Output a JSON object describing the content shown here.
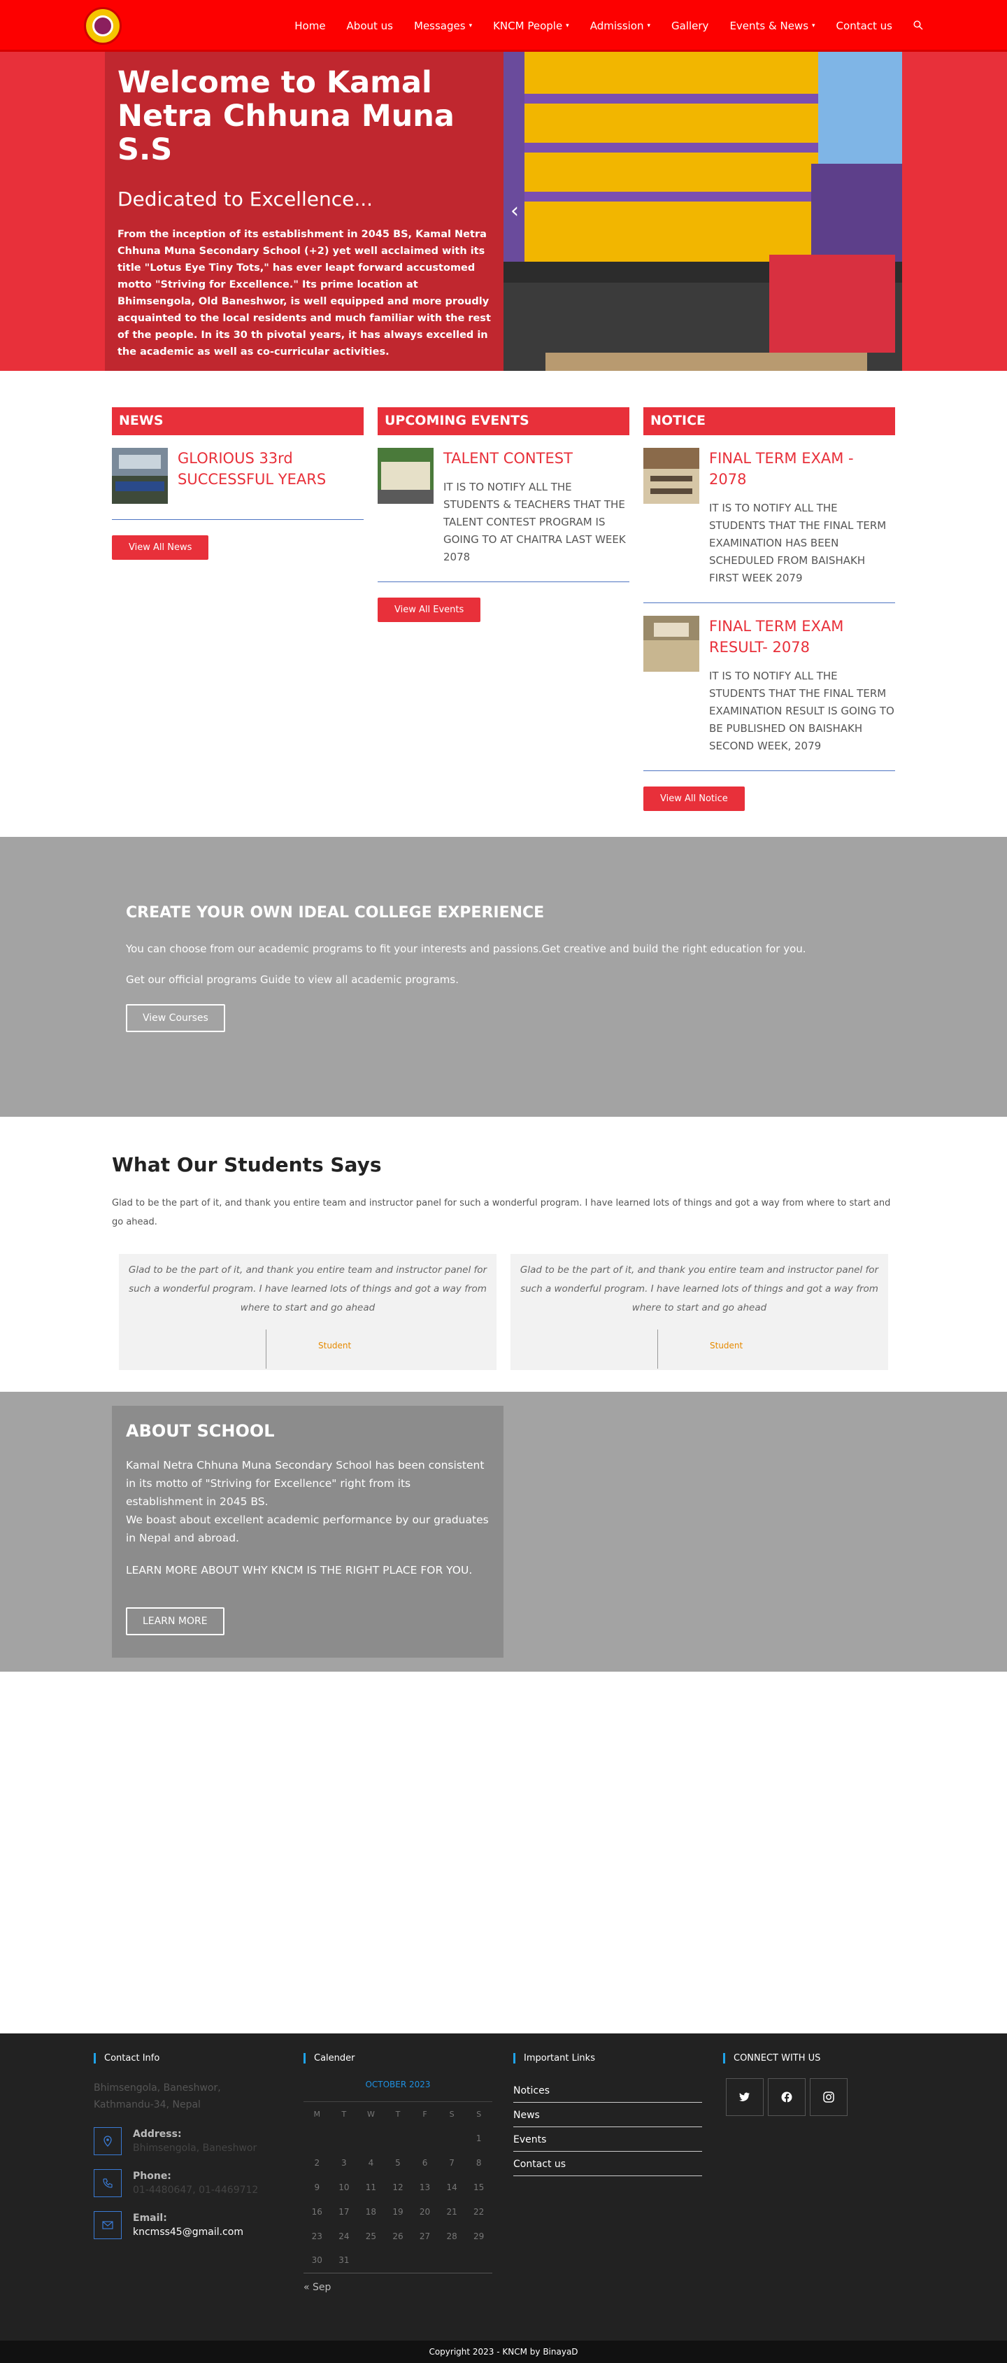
{
  "nav": {
    "items": [
      {
        "label": "Home",
        "dropdown": false
      },
      {
        "label": "About us",
        "dropdown": false
      },
      {
        "label": "Messages",
        "dropdown": true
      },
      {
        "label": "KNCM People",
        "dropdown": true
      },
      {
        "label": "Admission",
        "dropdown": true
      },
      {
        "label": "Gallery",
        "dropdown": false
      },
      {
        "label": "Events & News",
        "dropdown": true
      },
      {
        "label": "Contact us",
        "dropdown": false
      }
    ],
    "caret": "▾"
  },
  "hero": {
    "title": "Welcome to Kamal Netra Chhuna Muna S.S",
    "subtitle": "Dedicated to Excellence...",
    "body": "From the inception of its establishment in 2045 BS, Kamal Netra Chhuna Muna Secondary School (+2) yet well acclaimed with its title \"Lotus Eye Tiny Tots,\" has ever leapt forward accustomed motto \"Striving for Excellence.\" Its prime location at Bhimsengola, Old Baneshwor, is well equipped and more proudly acquainted to the local residents and much familiar with the rest of the people. In its 30 th pivotal years, it has always excelled in the academic as well as co-curricular activities.",
    "prev_arrow": "‹"
  },
  "news": {
    "heading": "NEWS",
    "items": [
      {
        "title": "GLORIOUS 33rd SUCCESSFUL YEARS"
      }
    ],
    "button": "View All News"
  },
  "events": {
    "heading": "UPCOMING EVENTS",
    "items": [
      {
        "title": "TALENT CONTEST",
        "desc": "IT IS TO NOTIFY ALL THE STUDENTS & TEACHERS THAT THE TALENT CONTEST PROGRAM IS GOING TO AT CHAITRA LAST WEEK 2078"
      }
    ],
    "button": "View All Events"
  },
  "notice": {
    "heading": "NOTICE",
    "items": [
      {
        "title": "FINAL TERM EXAM - 2078",
        "desc": "IT IS TO NOTIFY ALL THE STUDENTS THAT THE FINAL TERM EXAMINATION HAS BEEN SCHEDULED FROM BAISHAKH FIRST WEEK 2079"
      },
      {
        "title": "FINAL TERM EXAM RESULT- 2078",
        "desc": "IT IS TO NOTIFY ALL THE STUDENTS THAT THE FINAL TERM EXAMINATION RESULT IS GOING TO BE PUBLISHED ON BAISHAKH SECOND WEEK, 2079"
      }
    ],
    "button": "View All Notice"
  },
  "cta": {
    "title": "CREATE YOUR OWN IDEAL COLLEGE EXPERIENCE",
    "line1": "You can choose from our academic programs to fit your interests and passions.Get creative and build the right education for you.",
    "line2": "Get our official programs Guide to view all academic programs.",
    "button": "View Courses"
  },
  "testimonials": {
    "title": "What Our Students Says",
    "intro": "Glad to be the part of it, and thank you entire team and instructor panel for such a wonderful program. I have learned lots of things and got a way from where to start and go ahead.",
    "cards": [
      {
        "quote": "Glad to be the part of it, and thank you entire team and instructor panel for such a wonderful program. I have learned lots of things and got a way from where to start and go ahead",
        "role": "Student"
      },
      {
        "quote": "Glad to be the part of it, and thank you entire team and instructor panel for such a wonderful program. I have learned lots of things and got a way from where to start and go ahead",
        "role": "Student"
      }
    ]
  },
  "about": {
    "title": "ABOUT SCHOOL",
    "p1": "Kamal Netra Chhuna Muna Secondary School has been consistent in its motto of \"Striving for Excellence\" right from its establishment in 2045 BS.",
    "p2": "We boast about excellent academic performance by our graduates in Nepal and abroad.",
    "p3": "LEARN MORE ABOUT WHY KNCM IS THE RIGHT PLACE FOR YOU.",
    "button": "LEARN MORE"
  },
  "footer": {
    "contact": {
      "heading": "Contact Info",
      "location": "Bhimsengola, Baneshwor, Kathmandu-34, Nepal",
      "address_label": "Address:",
      "address": "Bhimsengola, Baneshwor",
      "phone_label": "Phone:",
      "phone": "01-4480647, 01-4469712",
      "email_label": "Email:",
      "email": "kncmss45@gmail.com"
    },
    "calendar": {
      "heading": "Calender",
      "month": "OCTOBER 2023",
      "weekdays": [
        "M",
        "T",
        "W",
        "T",
        "F",
        "S",
        "S"
      ],
      "weeks": [
        [
          "",
          "",
          "",
          "",
          "",
          "",
          "1"
        ],
        [
          "2",
          "3",
          "4",
          "5",
          "6",
          "7",
          "8"
        ],
        [
          "9",
          "10",
          "11",
          "12",
          "13",
          "14",
          "15"
        ],
        [
          "16",
          "17",
          "18",
          "19",
          "20",
          "21",
          "22"
        ],
        [
          "23",
          "24",
          "25",
          "26",
          "27",
          "28",
          "29"
        ],
        [
          "30",
          "31",
          "",
          "",
          "",
          "",
          ""
        ]
      ],
      "prev": "« Sep"
    },
    "links": {
      "heading": "Important Links",
      "items": [
        "Notices",
        "News",
        "Events",
        "Contact us"
      ]
    },
    "social": {
      "heading": "CONNECT WITH US",
      "icons": [
        "twitter-icon",
        "facebook-icon",
        "instagram-icon"
      ]
    },
    "copyright": "Copyright 2023 - KNCM by BinayaD"
  },
  "colors": {
    "header": "#fd0000",
    "accent": "#e8303a",
    "gray_section": "#a3a3a3",
    "footer": "#222222"
  }
}
